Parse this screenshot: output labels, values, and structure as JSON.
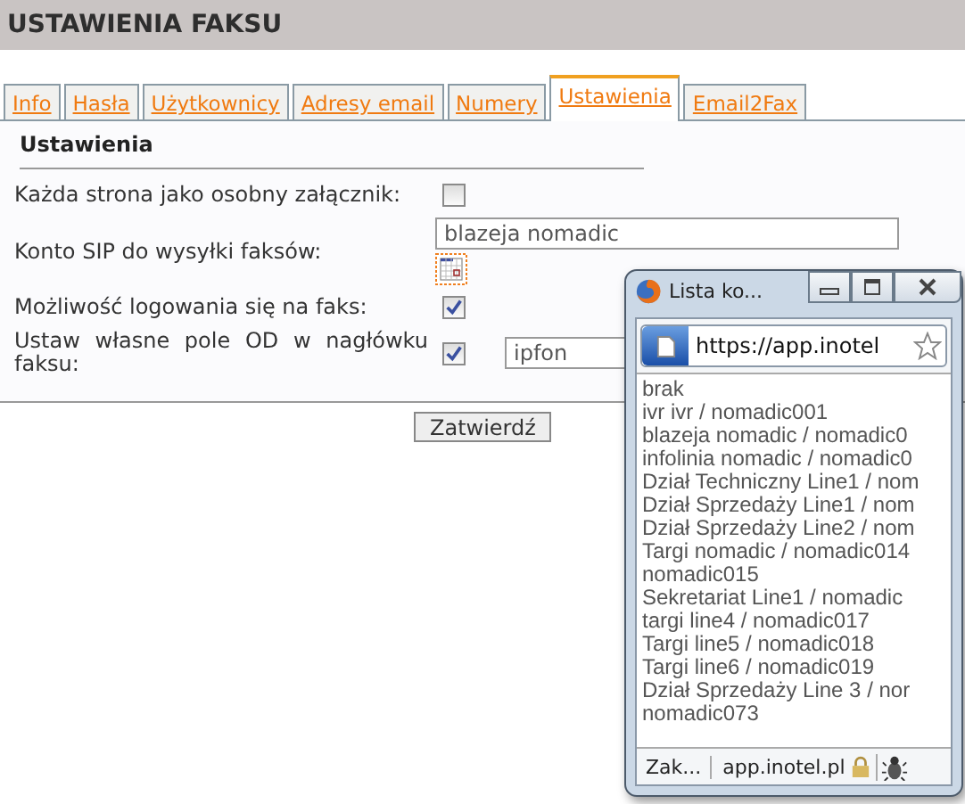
{
  "header": {
    "title": "USTAWIENIA FAKSU"
  },
  "tabs": [
    {
      "label": "Info",
      "selected": false
    },
    {
      "label": "Hasła",
      "selected": false
    },
    {
      "label": "Użytkownicy",
      "selected": false
    },
    {
      "label": "Adresy email",
      "selected": false
    },
    {
      "label": "Numery",
      "selected": false
    },
    {
      "label": "Ustawienia",
      "selected": true
    },
    {
      "label": "Email2Fax",
      "selected": false
    }
  ],
  "section": {
    "title": "Ustawienia"
  },
  "rows": [
    {
      "kind": "checkbox",
      "label": "Każda strona jako osobny załącznik:",
      "checked": false
    },
    {
      "kind": "select",
      "label": "Konto SIP do wysyłki faksów:",
      "value": "blazeja nomadic"
    },
    {
      "kind": "checkbox",
      "label": "Możliwość logowania się na faks:",
      "checked": true
    },
    {
      "kind": "checkbox_text",
      "label": "Ustaw własne pole OD w nagłówku faksu:",
      "checked": true,
      "value": "ipfon"
    }
  ],
  "submit": "Zatwierdź",
  "popup": {
    "title": "Lista ko...",
    "url": "https://app.inotel",
    "items": [
      "brak",
      "ivr ivr / nomadic001",
      "blazeja nomadic / nomadic0",
      "infolinia nomadic / nomadic0",
      "Dział Techniczny Line1 / nom",
      "Dział Sprzedaży Line1 / nom",
      "Dział Sprzedaży Line2 / nom",
      "Targi nomadic / nomadic014",
      "nomadic015",
      "Sekretariat Line1 / nomadic",
      "targi line4 / nomadic017",
      "Targi line5 / nomadic018",
      "Targi line6 / nomadic019",
      "Dział Sprzedaży Line 3 / nor",
      "nomadic073"
    ],
    "status": "Zak...",
    "domain": "app.inotel.pl"
  }
}
